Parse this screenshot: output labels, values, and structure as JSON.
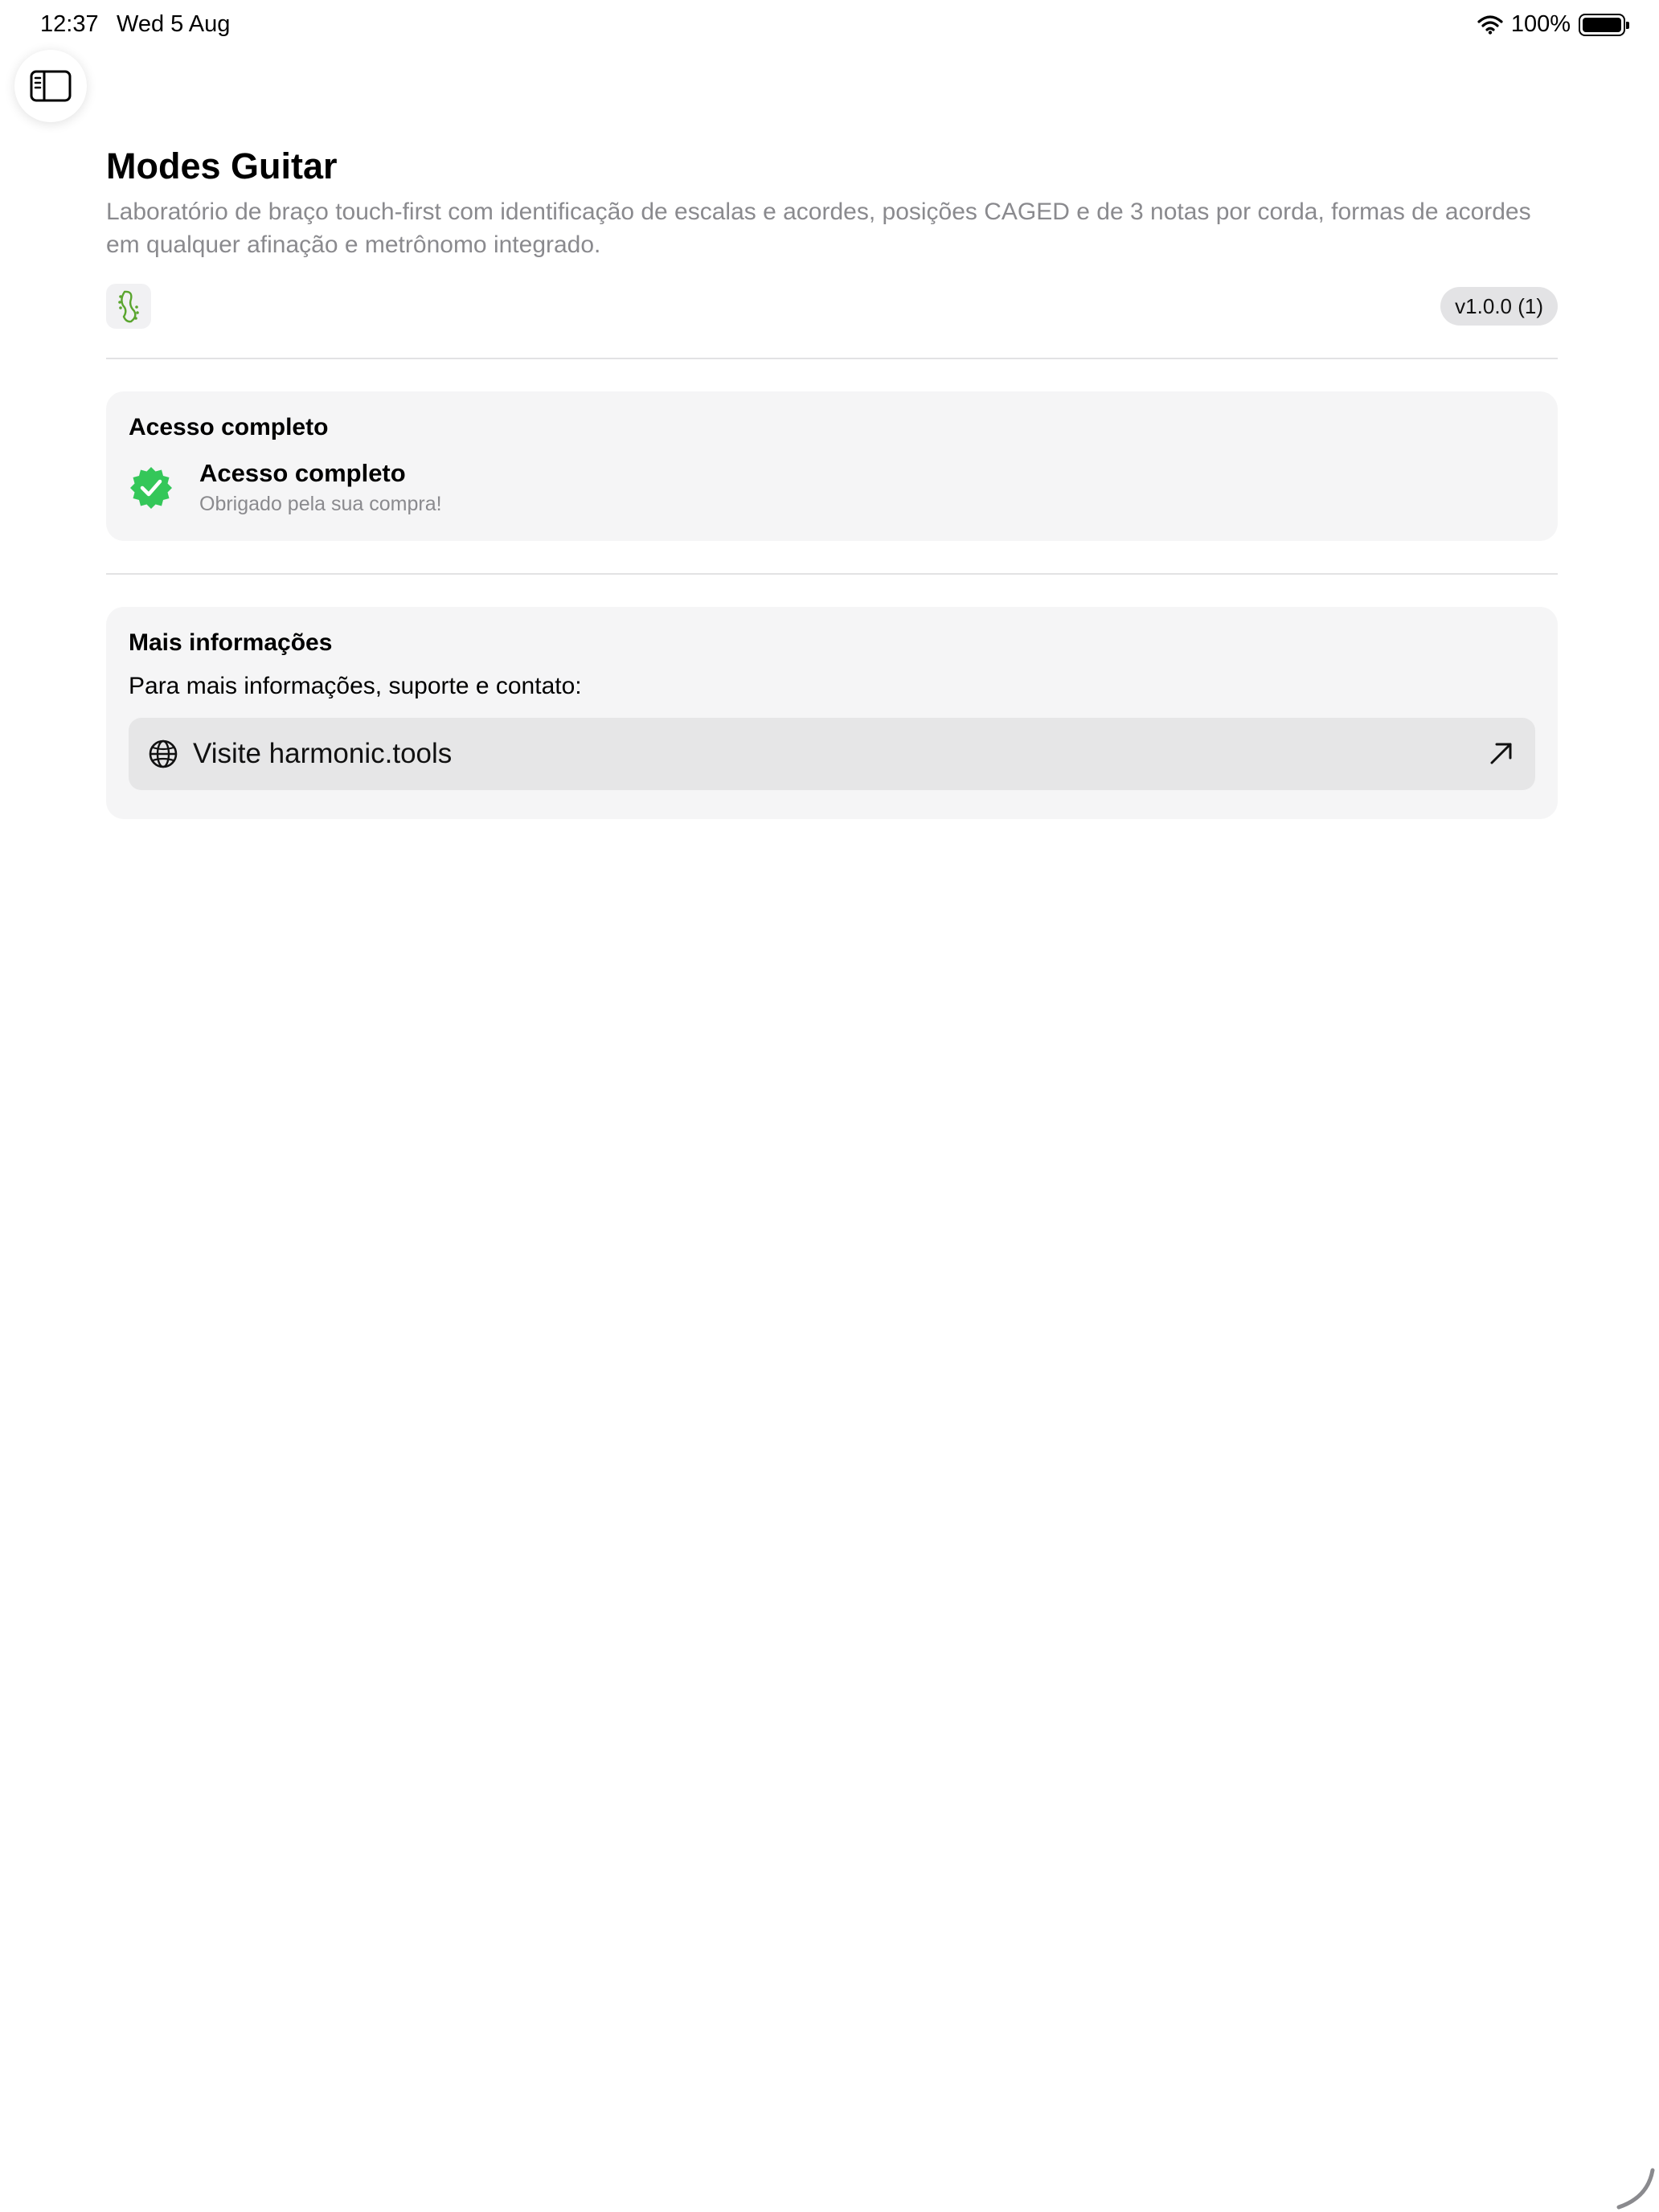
{
  "status_bar": {
    "time": "12:37",
    "date": "Wed 5 Aug",
    "battery": "100%",
    "wifi_icon": "wifi-icon",
    "battery_icon": "battery-icon"
  },
  "toolbar": {
    "sidebar_toggle_icon": "sidebar-toggle-icon"
  },
  "app": {
    "title": "Modes Guitar",
    "description": "Laboratório de braço touch-first com identificação de escalas e acordes, posições CAGED e de 3 notas por corda, formas de acordes em qualquer afinação e metrônomo integrado.",
    "icon": "guitar-headstock-icon",
    "version": "v1.0.0 (1)"
  },
  "access_card": {
    "heading": "Acesso completo",
    "status_title": "Acesso completo",
    "status_subtitle": "Obrigado pela sua compra!",
    "badge_icon": "verified-check-icon",
    "badge_color": "#34c759"
  },
  "info_card": {
    "heading": "Mais informações",
    "text": "Para mais informações, suporte e contato:",
    "link_label": "Visite harmonic.tools",
    "link_icon": "globe-icon",
    "external_icon": "arrow-up-right-icon"
  }
}
